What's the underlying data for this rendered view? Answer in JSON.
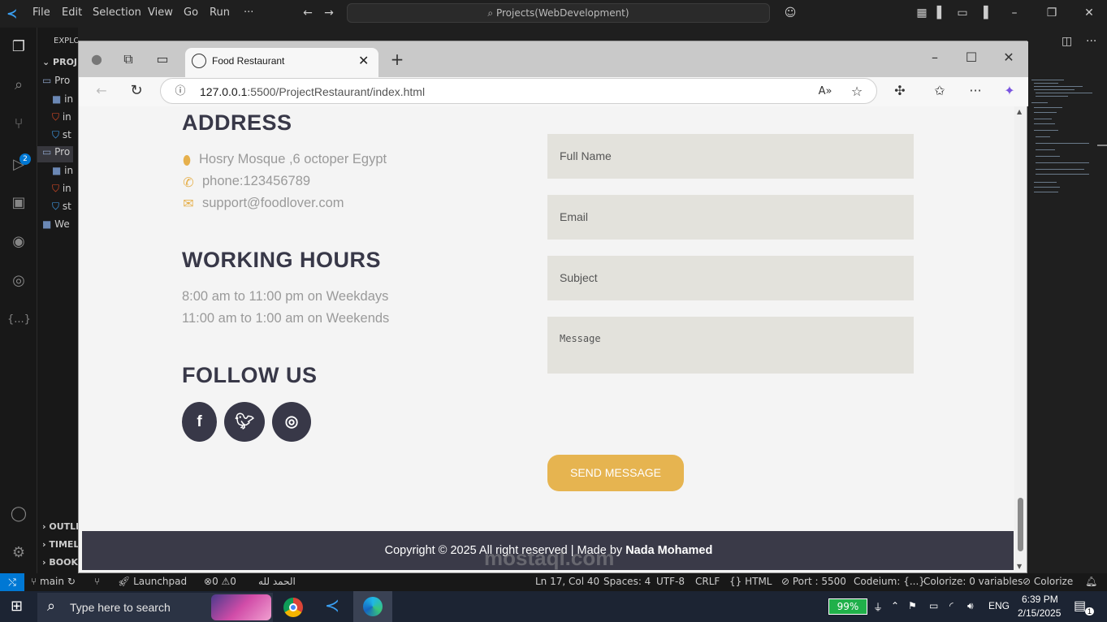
{
  "vscode": {
    "menu": [
      "File",
      "Edit",
      "Selection",
      "View",
      "Go",
      "Run",
      "···"
    ],
    "command_center": "Projects(WebDevelopment)",
    "explorer_label": "EXPLORER",
    "sidebar": {
      "rows": [
        "PROJ",
        "Pro",
        "in",
        "in",
        "st",
        "Pro",
        "in",
        "in",
        "st",
        "We"
      ],
      "sections": [
        "OUTLI",
        "TIMEL",
        "BOOK"
      ]
    },
    "scm_badge": "2",
    "extension_icon_label": "{...}",
    "status": {
      "branch": "main",
      "launchpad": "Launchpad",
      "problems": "0",
      "warnings": "0",
      "arabic": "الحمد لله",
      "position": "Ln 17, Col 40",
      "spaces": "Spaces: 4",
      "encoding": "UTF-8",
      "eol": "CRLF",
      "language": "HTML",
      "port": "Port : 5500",
      "codeium": "Codeium: {...}",
      "colorize_vars": "Colorize: 0 variables",
      "colorize": "Colorize"
    }
  },
  "browser": {
    "tab_title": "Food Restaurant",
    "url_host": "127.0.0.1",
    "url_rest": ":5500/ProjectRestaurant/index.html"
  },
  "page": {
    "address": {
      "heading": "ADDRESS",
      "location": "Hosry Mosque ,6 octoper Egypt",
      "phone": "phone:123456789",
      "email": "support@foodlover.com"
    },
    "hours": {
      "heading": "WORKING HOURS",
      "weekdays": "8:00 am to 11:00 pm on Weekdays",
      "weekends": "11:00 am to 1:00 am on Weekends"
    },
    "follow": {
      "heading": "FOLLOW US",
      "icons": [
        "facebook-icon",
        "twitter-icon",
        "instagram-icon"
      ]
    },
    "form": {
      "full_name": "Full Name",
      "email": "Email",
      "subject": "Subject",
      "message": "Message",
      "send": "SEND MESSAGE"
    },
    "footer": {
      "text": "Copyright © 2025 All right reserved | Made by",
      "author": "Nada Mohamed"
    },
    "colors": {
      "accent": "#e6b450",
      "dark": "#383848",
      "field": "#e3e2dc"
    }
  },
  "taskbar": {
    "search_placeholder": "Type here to search",
    "battery": "99%",
    "language": "ENG",
    "time": "6:39 PM",
    "date": "2/15/2025",
    "notification_count": "1"
  },
  "watermark": "mostaql.com"
}
